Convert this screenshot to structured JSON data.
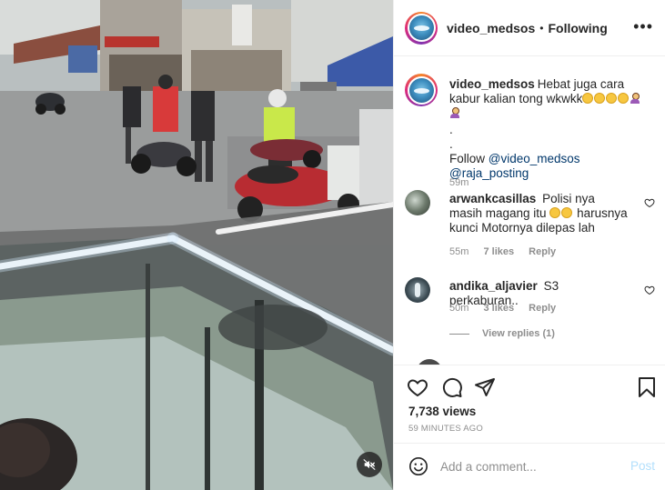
{
  "video": {
    "mute_icon": "speaker-muted-icon"
  },
  "header": {
    "username": "video_medsos",
    "separator": "•",
    "follow_status": "Following",
    "more_icon": "more-options-icon",
    "more_label": "•••"
  },
  "caption": {
    "username": "video_medsos",
    "text": "Hebat juga cara kabur kalian tong wkwkk",
    "dots": ".",
    "follow_prefix": "Follow",
    "mention_1": "@video_medsos",
    "mention_2": "@raja_posting",
    "time": "59m"
  },
  "comments": [
    {
      "username": "arwankcasillas",
      "text_1": "Polisi nya masih magang itu",
      "text_2": "harusnya kunci Motornya dilepas lah",
      "time": "55m",
      "likes": "7 likes",
      "reply": "Reply"
    },
    {
      "username": "andika_aljavier",
      "text": "S3 perkaburan..",
      "time": "50m",
      "likes": "3 likes",
      "reply": "Reply"
    }
  ],
  "view_replies": "View replies (1)",
  "actions": {
    "views": "7,738 views",
    "time_ago": "59 MINUTES AGO"
  },
  "composer": {
    "placeholder": "Add a comment...",
    "post_label": "Post"
  },
  "colors": {
    "link": "#00376b",
    "muted": "#8e8e8e",
    "post_disabled": "#b2dffc",
    "text": "#262626"
  }
}
